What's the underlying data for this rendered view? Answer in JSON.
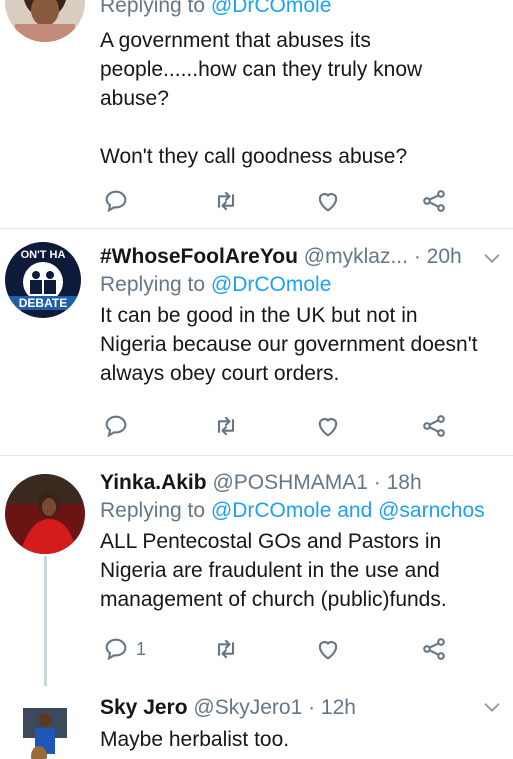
{
  "tweets": [
    {
      "reply_prefix": "Replying to ",
      "reply_to": "@DrCOmole",
      "body": [
        "A government that abuses its",
        "people......how can they truly know",
        "abuse?",
        "",
        "Won't they call goodness abuse?"
      ],
      "reply_count": ""
    },
    {
      "name": "#WhoseFoolAreYou",
      "handle": "@myklaz...",
      "time": "· 20h",
      "reply_prefix": "Replying to ",
      "reply_to": "@DrCOmole",
      "body": [
        "It can be good in the UK but not in",
        "Nigeria because our government doesn't",
        "always obey court orders."
      ],
      "avatar_text_top": "ON'T HA",
      "avatar_text_bottom": "DEBATE",
      "reply_count": ""
    },
    {
      "name": "Yinka.Akib",
      "handle": "@POSHMAMA1",
      "time": "· 18h",
      "reply_prefix": "Replying to ",
      "reply_to": "@DrCOmole and @sarnchos",
      "body": [
        "ALL Pentecostal GOs and Pastors in",
        "Nigeria are fraudulent in the use and",
        "management of church (public)funds."
      ],
      "reply_count": "1"
    },
    {
      "name": "Sky Jero",
      "handle": "@SkyJero1",
      "time": "· 12h",
      "body": [
        "Maybe herbalist too."
      ]
    }
  ],
  "icons": {
    "reply": "reply-icon",
    "retweet": "retweet-icon",
    "like": "heart-icon",
    "share": "share-icon",
    "caret": "chevron-down-icon"
  },
  "colors": {
    "link": "#1da1f2",
    "muted": "#657786",
    "text": "#14171a",
    "divider": "#dfe3e7"
  }
}
